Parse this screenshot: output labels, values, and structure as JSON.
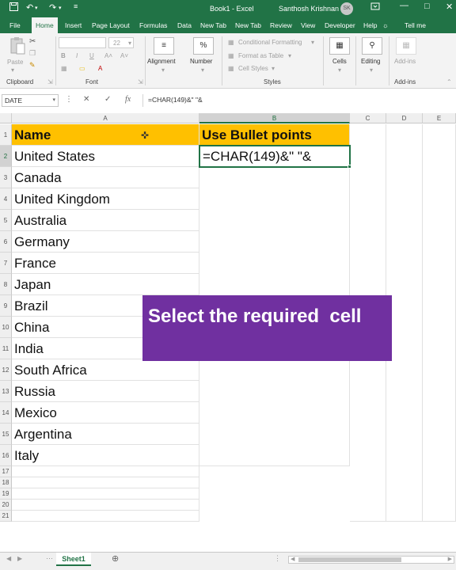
{
  "titlebar": {
    "title": "Book1 - Excel",
    "user": "Santhosh Krishnan",
    "avatar_initials": "SK"
  },
  "tabs": [
    "File",
    "Home",
    "Insert",
    "Page Layout",
    "Formulas",
    "Data",
    "New Tab",
    "New Tab",
    "Review",
    "View",
    "Developer",
    "Help",
    "Tell me"
  ],
  "ribbon": {
    "clipboard": {
      "paste": "Paste",
      "label": "Clipboard"
    },
    "font": {
      "name": "",
      "size": "22",
      "label": "Font"
    },
    "alignment": {
      "label": "Alignment"
    },
    "number": {
      "label": "Number",
      "symbol": "%"
    },
    "styles": {
      "conditional_formatting": "Conditional Formatting",
      "format_as_table": "Format as Table",
      "cell_styles": "Cell Styles",
      "label": "Styles"
    },
    "cells": {
      "label": "Cells"
    },
    "editing": {
      "label": "Editing"
    },
    "addins": {
      "button": "Add-ins",
      "label": "Add-ins"
    }
  },
  "formula_bar": {
    "name_box": "DATE",
    "formula": "=CHAR(149)&\" \"&"
  },
  "grid": {
    "columns": [
      "A",
      "B",
      "C",
      "D",
      "E"
    ],
    "headers": {
      "name": "Name",
      "bullets": "Use Bullet points"
    },
    "editing_cell": "=CHAR(149)&\" \"&",
    "rows": [
      "1",
      "2",
      "3",
      "4",
      "5",
      "6",
      "7",
      "8",
      "9",
      "10",
      "11",
      "12",
      "13",
      "14",
      "15",
      "16",
      "17",
      "18",
      "19",
      "20",
      "21"
    ],
    "countries": [
      "United States",
      "Canada",
      "United Kingdom",
      "Australia",
      "Germany",
      "France",
      "Japan",
      "Brazil",
      "China",
      "India",
      "South Africa",
      "Russia",
      "Mexico",
      "Argentina",
      "Italy"
    ]
  },
  "banner": {
    "text": "Select the required  cell",
    "color": "#7030a0"
  },
  "sheets": {
    "active": "Sheet1"
  },
  "colors": {
    "excel_green": "#217346",
    "header_fill": "#ffc000"
  }
}
